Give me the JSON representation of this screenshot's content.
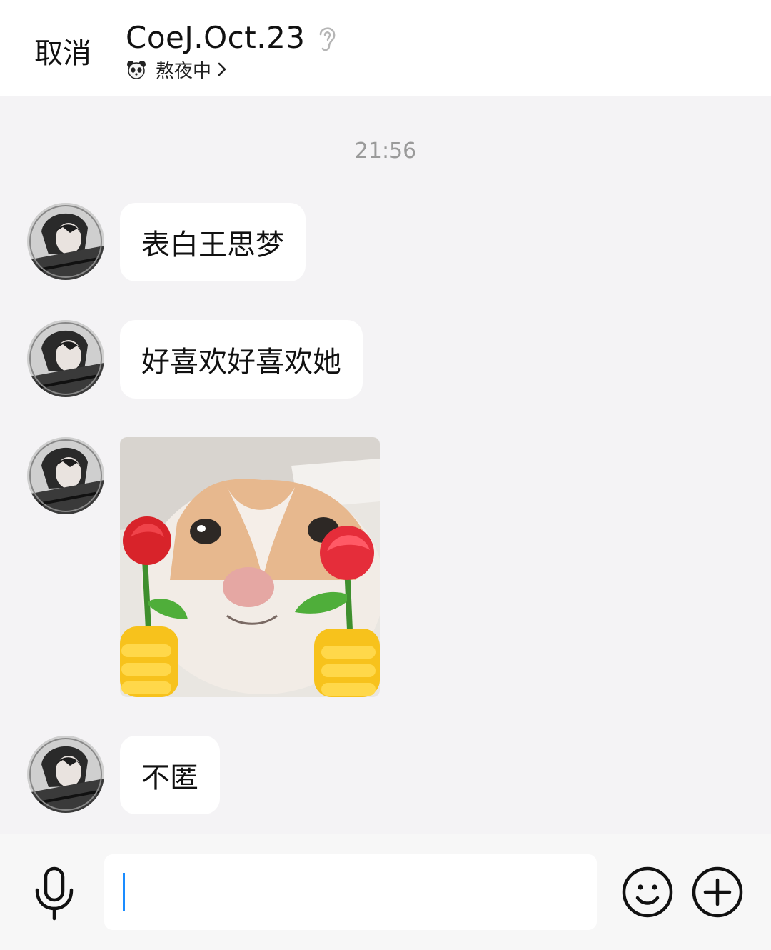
{
  "header": {
    "cancel_label": "取消",
    "title": "CoeJ.Oct.23",
    "status": "熬夜中"
  },
  "chat": {
    "timestamp": "21:56",
    "messages": [
      {
        "type": "text",
        "text": "表白王思梦"
      },
      {
        "type": "text",
        "text": "好喜欢好喜欢她"
      },
      {
        "type": "sticker",
        "description": "cat-holding-roses-sticker"
      },
      {
        "type": "text",
        "text": "不匿"
      }
    ]
  },
  "input": {
    "value": "",
    "mic_icon": "mic-icon",
    "emoji_icon": "smiley-icon",
    "plus_icon": "plus-circle-icon"
  },
  "colors": {
    "background": "#f4f3f5",
    "bubble": "#ffffff",
    "caret": "#1a8cff",
    "timestamp": "#9a9a9a"
  }
}
